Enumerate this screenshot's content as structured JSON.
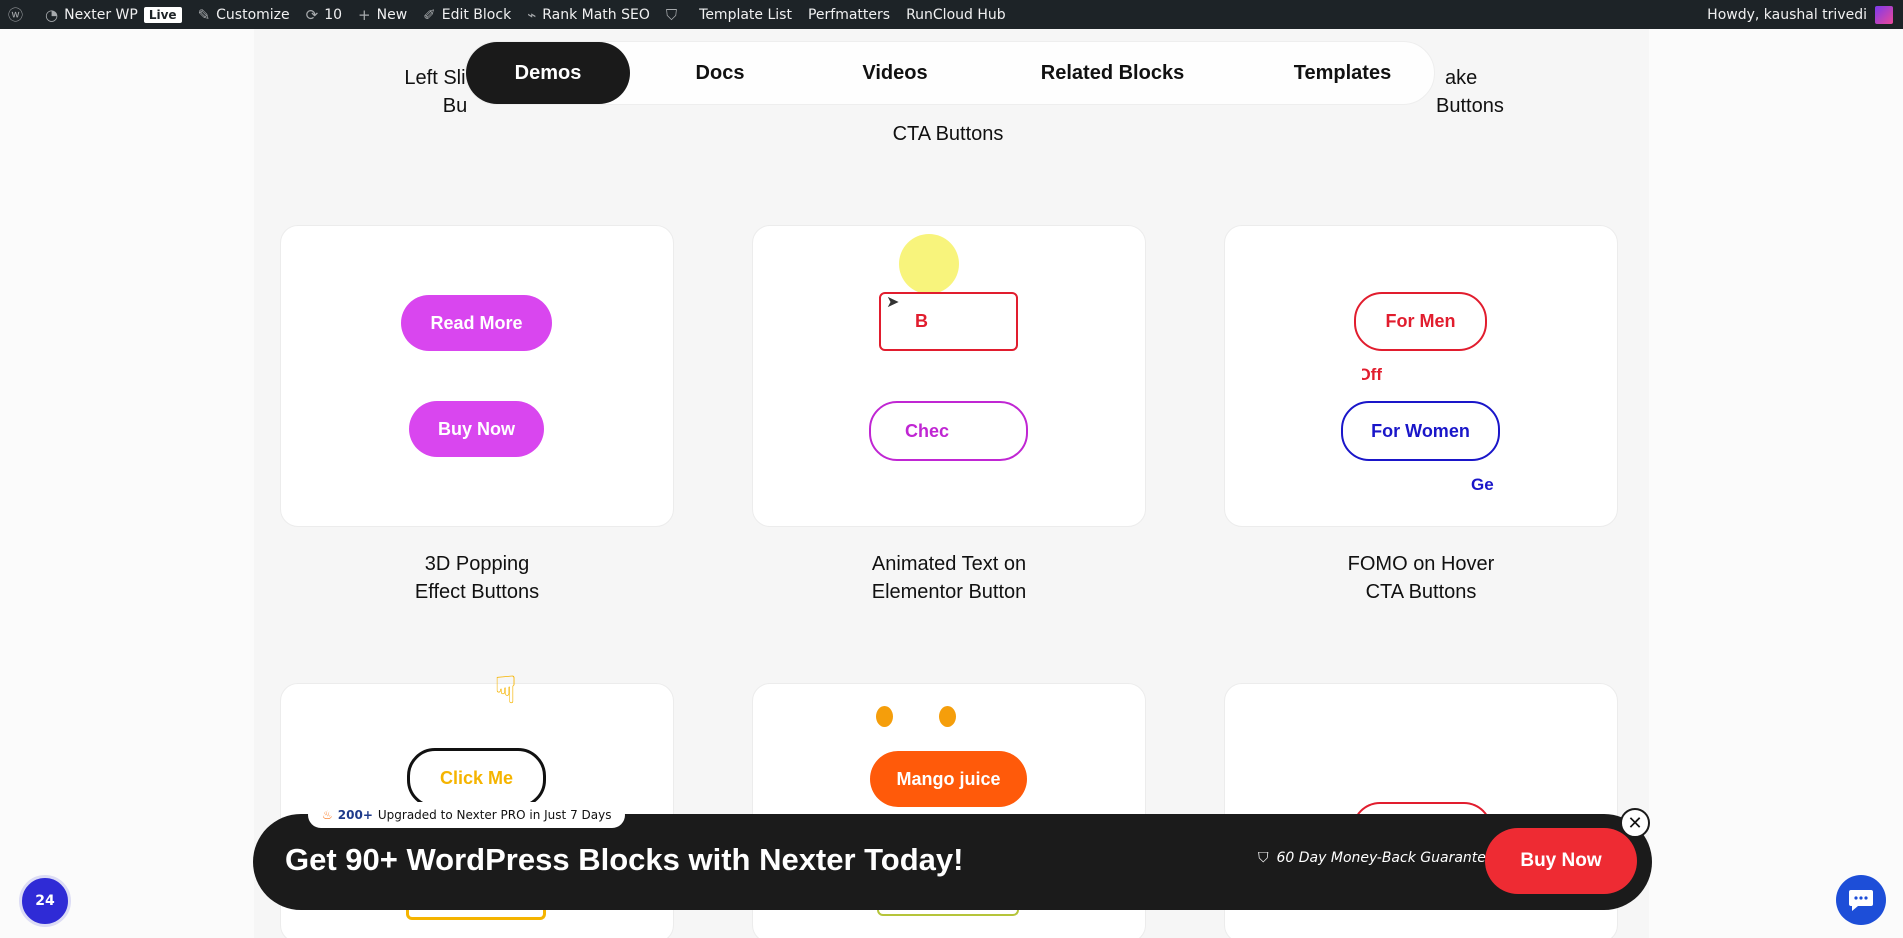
{
  "admin_bar": {
    "site_name": "Nexter WP",
    "live_badge": "Live",
    "customize": "Customize",
    "updates_count": "10",
    "new": "New",
    "edit_block": "Edit Block",
    "rank_math": "Rank Math SEO",
    "template_list": "Template List",
    "perfmatters": "Perfmatters",
    "runcloud": "RunCloud Hub",
    "greeting": "Howdy, kaushal trivedi"
  },
  "tabs": [
    {
      "label": "Demos",
      "active": true
    },
    {
      "label": "Docs",
      "active": false
    },
    {
      "label": "Videos",
      "active": false
    },
    {
      "label": "Related Blocks",
      "active": false
    },
    {
      "label": "Templates",
      "active": false
    }
  ],
  "top_captions": {
    "left_line1": "Left Sli",
    "left_line2": "Bu",
    "center": "CTA Buttons",
    "right_line1": "ake",
    "right_line2": "Buttons"
  },
  "cards_row1": [
    {
      "caption_line1": "3D Popping",
      "caption_line2": "Effect Buttons",
      "button1": "Read More",
      "button2": "Buy Now"
    },
    {
      "caption_line1": "Animated Text on",
      "caption_line2": "Elementor Button",
      "button1": "B",
      "button2": "Chec"
    },
    {
      "caption_line1": "FOMO on Hover",
      "caption_line2": "CTA Buttons",
      "button1": "For Men",
      "sub1": "Off",
      "button2": "For Women",
      "sub2": "Ge"
    }
  ],
  "cards_row2": [
    {
      "button1": "Click Me"
    },
    {
      "button1": "Mango juice"
    },
    {}
  ],
  "promo": {
    "count": "200+",
    "pill_text": "Upgraded to Nexter PRO in Just 7 Days",
    "headline": "Get 90+ WordPress Blocks with Nexter Today!",
    "guarantee": "60 Day Money-Back Guarantee",
    "buy_now": "Buy Now"
  },
  "badge_24": "24",
  "colors": {
    "admin_bar": "#1d2327",
    "purple": "#d946ef",
    "red": "#e11d2e",
    "blue": "#1a16c9",
    "orange": "#ff5a0a",
    "yellow": "#f5b400",
    "banner": "#1b1b1b",
    "buy_red": "#ee2b33"
  }
}
